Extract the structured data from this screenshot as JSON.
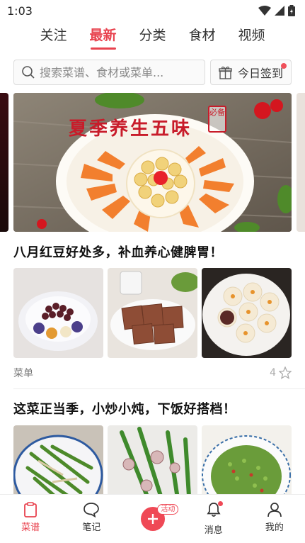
{
  "status_bar": {
    "time": "1:03"
  },
  "top_tabs": [
    {
      "label": "关注",
      "active": false
    },
    {
      "label": "最新",
      "active": true
    },
    {
      "label": "分类",
      "active": false
    },
    {
      "label": "食材",
      "active": false
    },
    {
      "label": "视频",
      "active": false
    }
  ],
  "search": {
    "placeholder": "搜索菜谱、食材或菜单..."
  },
  "checkin": {
    "label": "今日签到"
  },
  "banner": {
    "title": "夏季养生五味",
    "seal": "必备"
  },
  "articles": [
    {
      "title": "八月红豆好处多，补血养心健脾胃！",
      "tag": "菜单",
      "fav_count": "4"
    },
    {
      "title": "这菜正当季，小炒小炖，下饭好搭档！"
    }
  ],
  "bottom_nav": {
    "recipes": "菜谱",
    "notes": "笔记",
    "publish_badge": "活动",
    "messages": "消息",
    "me": "我的"
  },
  "colors": {
    "accent": "#e8424e"
  }
}
